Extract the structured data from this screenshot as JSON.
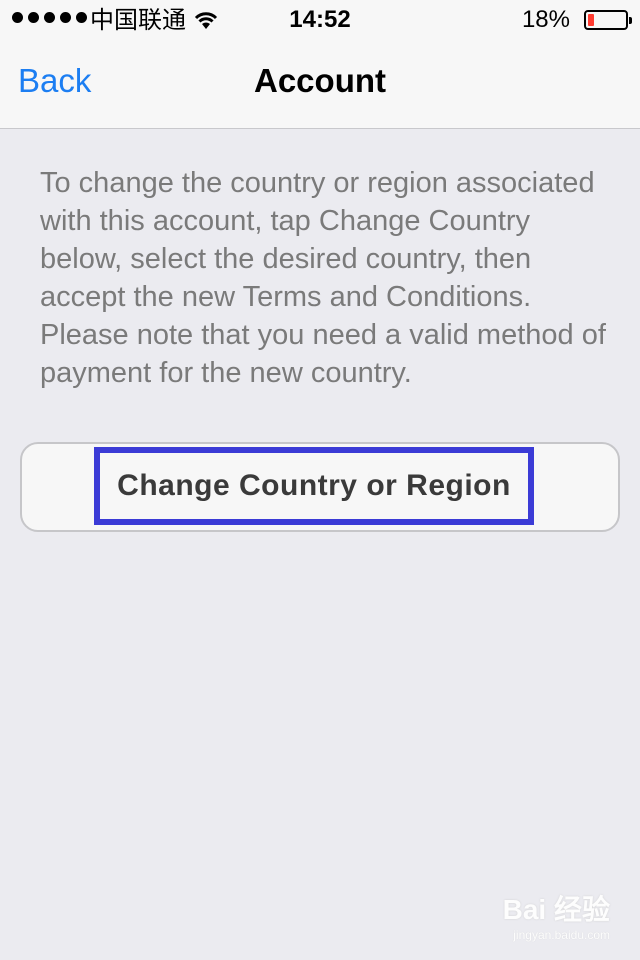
{
  "status_bar": {
    "carrier": "中国联通",
    "time": "14:52",
    "battery_percent_text": "18%",
    "battery_level": 0.18,
    "signal_bars": 5
  },
  "nav": {
    "back_label": "Back",
    "title": "Account"
  },
  "content": {
    "description": "To change the country or region associated with this account, tap Change Country below, select the desired country, then accept the new Terms and Conditions. Please note that you need a valid method of payment for the new country.",
    "change_button_label": "Change Country or Region"
  },
  "colors": {
    "accent": "#1c7ef2",
    "highlight_box": "#3b3bd6",
    "battery_low": "#ff3b30"
  },
  "watermark": {
    "text": "Bai 经验",
    "url": "jingyan.baidu.com"
  }
}
